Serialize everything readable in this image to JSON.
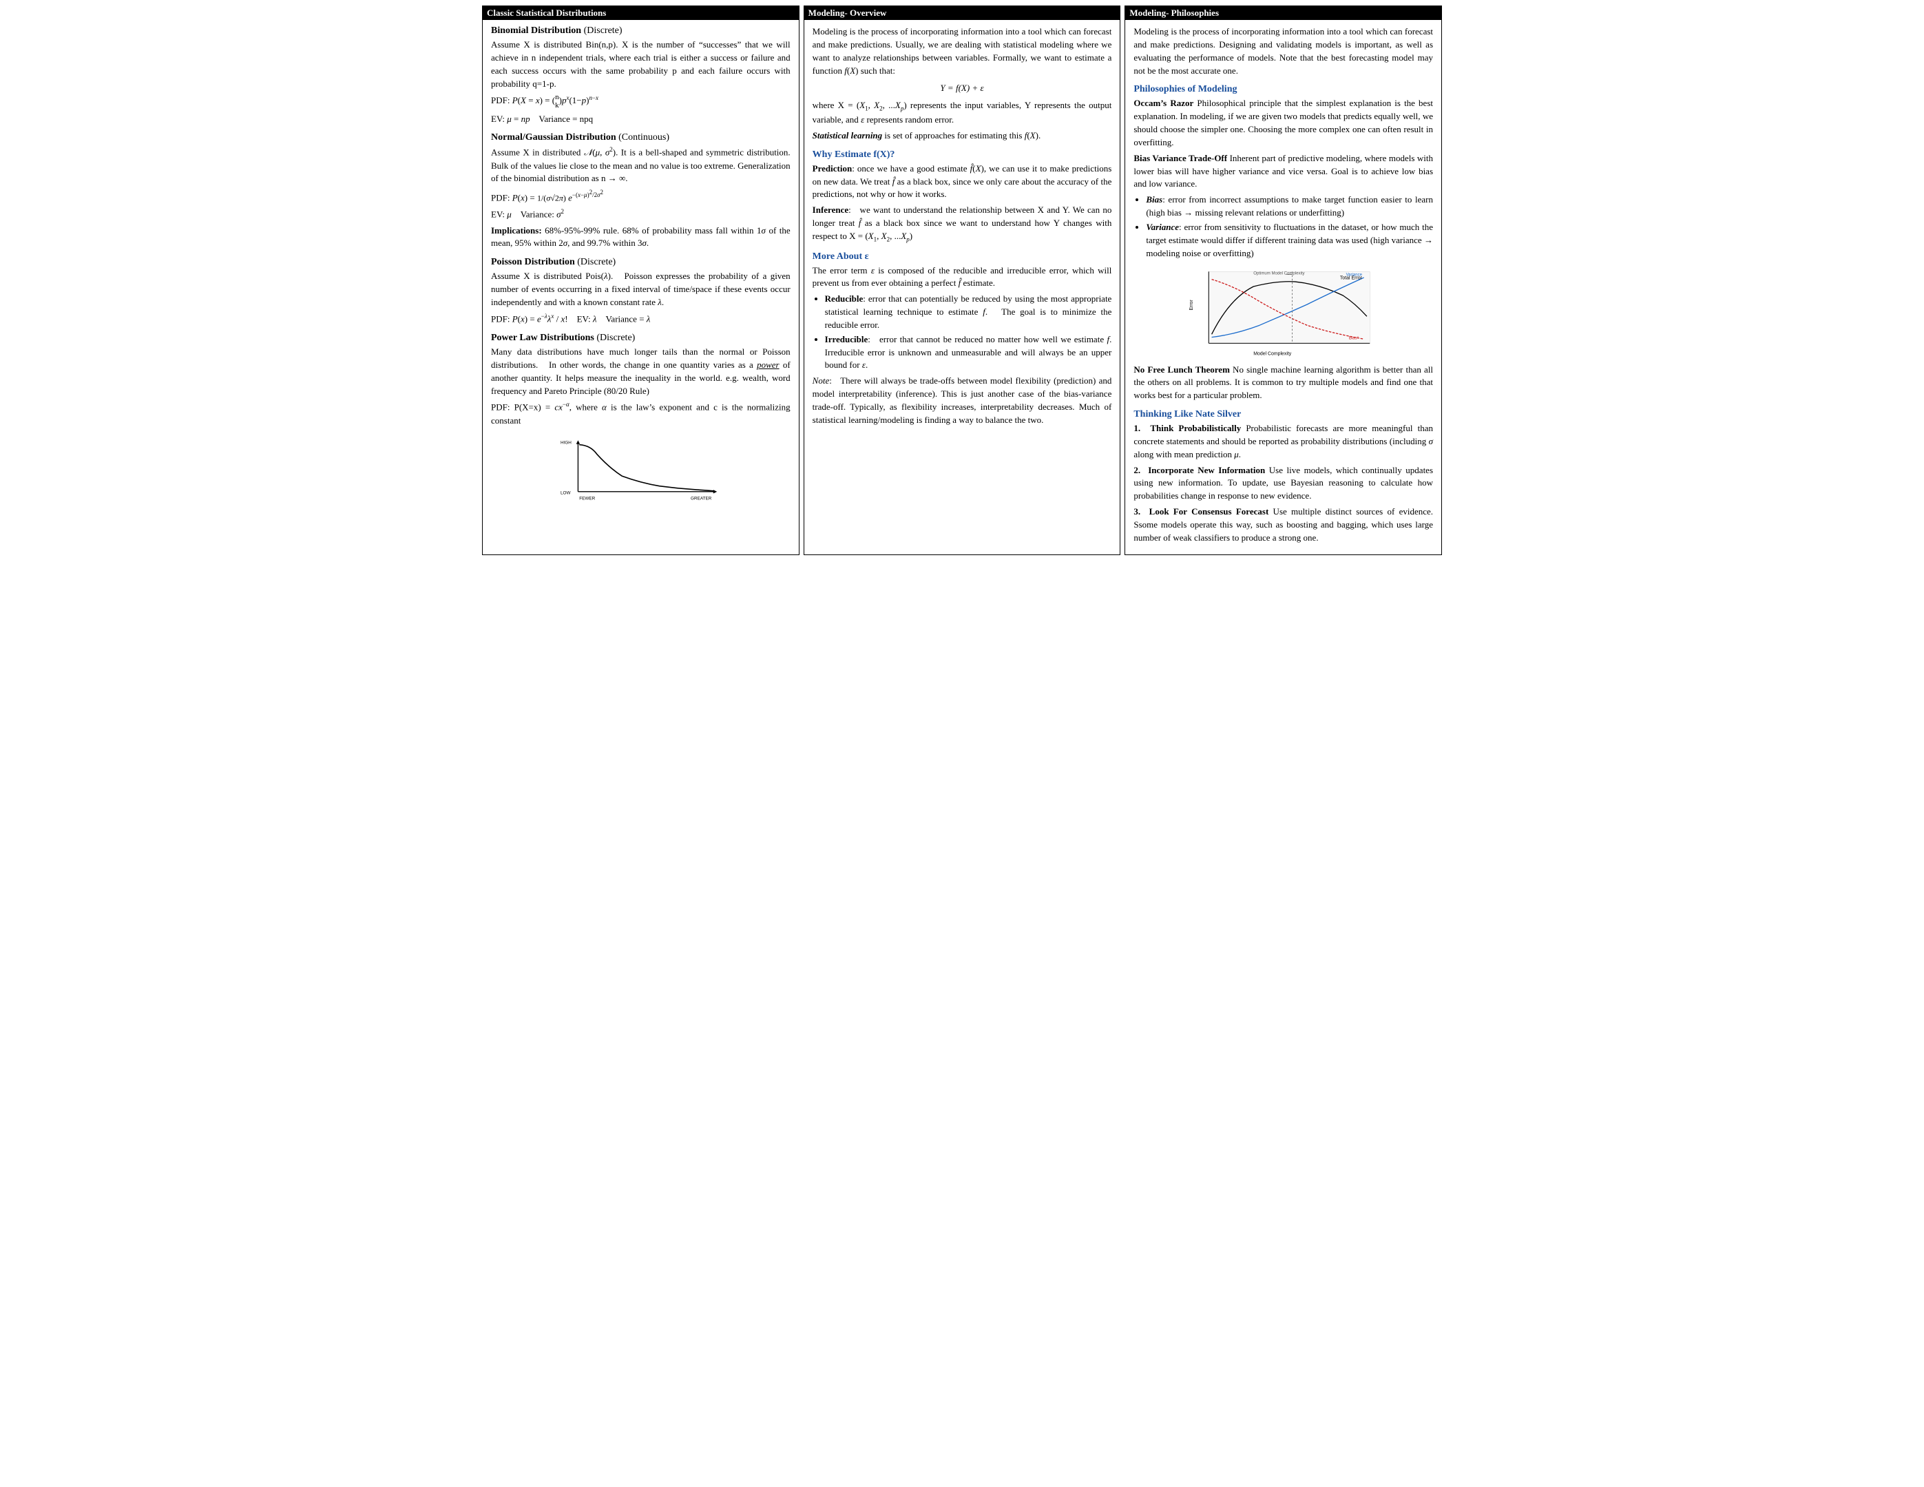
{
  "columns": {
    "col1": {
      "header": "Classic Statistical Distributions",
      "sections": [
        {
          "title": "Binomial Distribution",
          "title_suffix": "(Discrete)",
          "paragraphs": [
            "Assume X is distributed Bin(n,p). X is the number of \"successes\" that we will achieve in n independent trials, where each trial is either a success or failure and each success occurs with the same probability p and each failure occurs with probability q=1-p.",
            "PDF: P(X = x) = (n choose k) p^x (1−p)^(n−x)",
            "EV: μ = np   Variance = npq"
          ]
        },
        {
          "title": "Normal/Gaussian Distribution",
          "title_suffix": "(Continuous)",
          "paragraphs": [
            "Assume X in distributed 𝒩(μ, σ²). It is a bell-shaped and symmetric distribution. Bulk of the values lie close to the mean and no value is too extreme. Generalization of the binomial distribution as n → ∞.",
            "PDF: P(x) = (1/σ√2π) e^(−(x−μ)²/2σ²)",
            "EV: μ   Variance: σ²",
            "Implications: 68%-95%-99% rule. 68% of probability mass fall within 1σ of the mean, 95% within 2σ, and 99.7% within 3σ."
          ]
        },
        {
          "title": "Poisson Distribution",
          "title_suffix": "(Discrete)",
          "paragraphs": [
            "Assume X is distributed Pois(λ). Poisson expresses the probability of a given number of events occurring in a fixed interval of time/space if these events occur independently and with a known constant rate λ.",
            "PDF: P(x) = e^(−λ)λ^x / x!   EV: λ   Variance = λ"
          ]
        },
        {
          "title": "Power Law Distributions",
          "title_suffix": "(Discrete)",
          "paragraphs": [
            "Many data distributions have much longer tails than the normal or Poisson distributions. In other words, the change in one quantity varies as a power of another quantity. It helps measure the inequality in the world. e.g. wealth, word frequency and Pareto Principle (80/20 Rule)",
            "PDF: P(X=x) = cx^(−α), where α is the law's exponent and c is the normalizing constant"
          ],
          "chart": "power_law"
        }
      ]
    },
    "col2": {
      "header": "Modeling- Overview",
      "intro": "Modeling is the process of incorporating information into a tool which can forecast and make predictions. Usually, we are dealing with statistical modeling where we want to analyze relationships between variables. Formally, we want to estimate a function f(X) such that:",
      "formula": "Y = f(X) + ε",
      "formula_desc": "where X = (X₁, X₂, ...Xₚ) represents the input variables, Y represents the output variable, and ε represents random error.",
      "stat_learning_label": "Statistical learning",
      "stat_learning_text": " is set of approaches for estimating this f(X).",
      "sections": [
        {
          "heading": "Why Estimate f(X)?",
          "items": [
            {
              "label": "Prediction",
              "text": ": once we have a good estimate f̂(X), we can use it to make predictions on new data. We treat f̂ as a black box, since we only care about the accuracy of the predictions, not why or how it works."
            },
            {
              "label": "Inference",
              "text": ":  we want to understand the relationship between X and Y. We can no longer treat f̂ as a black box since we want to understand how Y changes with respect to X = (X₁, X₂, ...Xₚ)"
            }
          ]
        },
        {
          "heading": "More About ε",
          "intro": "The error term ε is composed of the reducible and irreducible error, which will prevent us from ever obtaining a perfect f̂ estimate.",
          "items": [
            {
              "label": "Reducible",
              "text": ": error that can potentially be reduced by using the most appropriate statistical learning technique to estimate f.  The goal is to minimize the reducible error."
            },
            {
              "label": "Irreducible",
              "text": ":  error that cannot be reduced no matter how well we estimate f. Irreducible error is unknown and unmeasurable and will always be an upper bound for ε."
            }
          ]
        }
      ],
      "note": "Note:  There will always be trade-offs between model flexibility (prediction) and model interpretability (inference). This is just another case of the bias-variance trade-off. Typically, as flexibility increases, interpretability decreases. Much of statistical learning/modeling is finding a way to balance the two."
    },
    "col3": {
      "header": "Modeling- Philosophies",
      "intro": "Modeling is the process of incorporating information into a tool which can forecast and make predictions. Designing and validating models is important, as well as evaluating the performance of models. Note that the best forecasting model may not be the most accurate one.",
      "sections": [
        {
          "heading": "Philosophies of Modeling",
          "items": [
            {
              "label": "Occam's Razor",
              "text": " Philosophical principle that the simplest explanation is the best explanation. In modeling, if we are given two models that predicts equally well, we should choose the simpler one. Choosing the more complex one can often result in overfitting."
            },
            {
              "label": "Bias Variance Trade-Off",
              "text": " Inherent part of predictive modeling, where models with lower bias will have higher variance and vice versa. Goal is to achieve low bias and low variance."
            }
          ],
          "bullet_items": [
            {
              "label": "Bias",
              "text": ": error from incorrect assumptions to make target function easier to learn (high bias → missing relevant relations or underfitting)"
            },
            {
              "label": "Variance",
              "text": ": error from sensitivity to fluctuations in the dataset, or how much the target estimate would differ if different training data was used (high variance → modeling noise or overfitting)"
            }
          ],
          "chart": "bias_variance"
        },
        {
          "label": "No Free Lunch Theorem",
          "text": " No single machine learning algorithm is better than all the others on all problems. It is common to try multiple models and find one that works best for a particular problem."
        }
      ],
      "thinking_section": {
        "heading": "Thinking Like Nate Silver",
        "items": [
          {
            "number": "1.",
            "label": "Think Probabilistically",
            "text": " Probabilistic forecasts are more meaningful than concrete statements and should be reported as probability distributions (including σ along with mean prediction μ."
          },
          {
            "number": "2.",
            "label": "Incorporate New Information",
            "text": " Use live models, which continually updates using new information. To update, use Bayesian reasoning to calculate how probabilities change in response to new evidence."
          },
          {
            "number": "3.",
            "label": "Look For Consensus Forecast",
            "text": " Use multiple distinct sources of evidence. Ssome models operate this way, such as boosting and bagging, which uses large number of weak classifiers to produce a strong one."
          }
        ]
      }
    }
  },
  "chart_labels": {
    "power_law": {
      "y_high": "HIGH",
      "y_low": "LOW",
      "x_fewer": "FEWER",
      "x_greater": "GREATER"
    },
    "bias_variance": {
      "y_label": "Error",
      "x_label": "Model Complexity",
      "total_error": "Total Error",
      "variance": "Variance",
      "bias_sq": "Bias²",
      "optimal": "Optimum Model Complexity"
    }
  }
}
